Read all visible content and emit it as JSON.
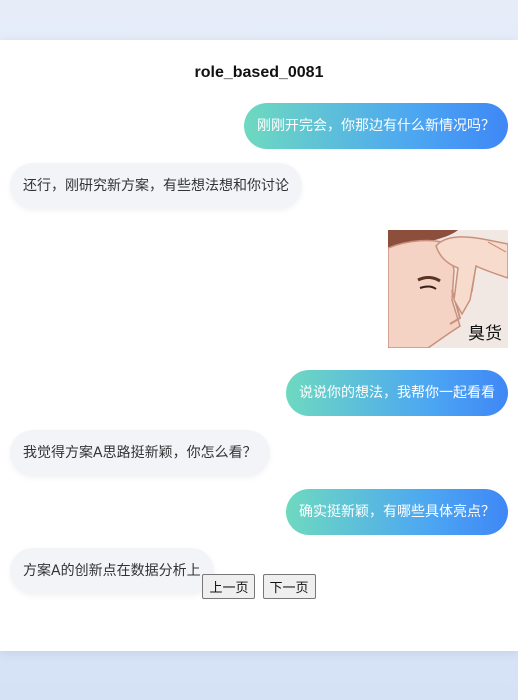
{
  "conversation": {
    "title": "role_based_0081",
    "messages": [
      {
        "side": "right",
        "text": "刚刚开完会，你那边有什么新情况吗？"
      },
      {
        "side": "left",
        "text": "还行，刚研究新方案，有些想法想和你讨论"
      },
      {
        "side": "right",
        "type": "sticker",
        "caption": "臭货"
      },
      {
        "side": "right",
        "text": "说说你的想法，我帮你一起看看"
      },
      {
        "side": "left",
        "text": "我觉得方案A思路挺新颖，你怎么看？"
      },
      {
        "side": "right",
        "text": "确实挺新颖，有哪些具体亮点？"
      },
      {
        "side": "left",
        "text": "方案A的创新点在数据分析上"
      }
    ]
  },
  "pagination": {
    "prev_label": "上一页",
    "next_label": "下一页"
  }
}
